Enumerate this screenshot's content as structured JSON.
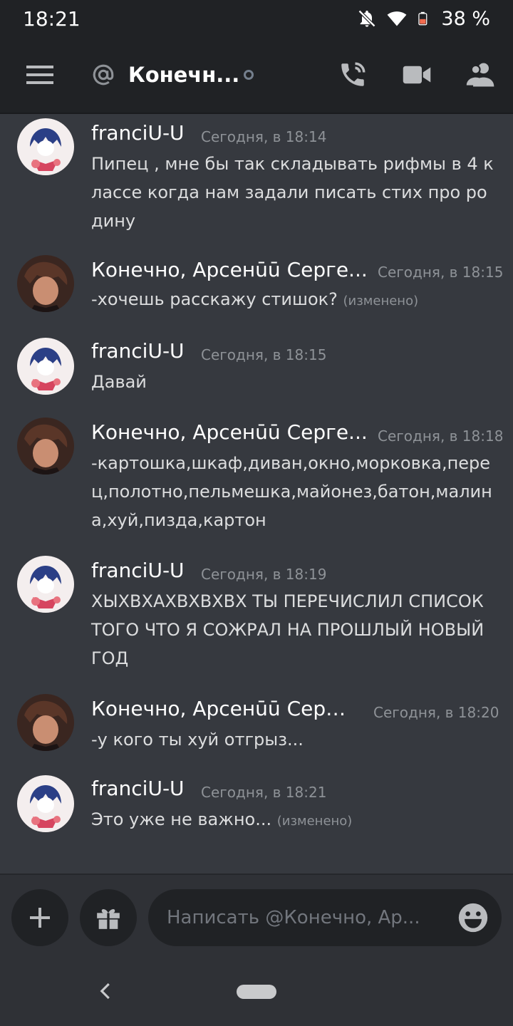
{
  "status_bar": {
    "time": "18:21",
    "battery": "38 %",
    "icons": [
      "bell-off-icon",
      "wifi-icon",
      "battery-icon"
    ]
  },
  "header": {
    "title": "Конечн...",
    "icons": [
      "menu-icon",
      "at-icon",
      "status-dot-icon",
      "call-icon",
      "video-icon",
      "members-icon"
    ]
  },
  "messages": [
    {
      "author": "franciU-U",
      "time": "Сегодня, в 18:14",
      "text": "Пипец , мне бы так складывать рифмы в 4 классе когда нам задали писать стих про родину",
      "edited": ""
    },
    {
      "author": "Конечно, Арсенūū Серге...",
      "time": "Сегодня, в 18:15",
      "text": "-хочешь расскажу стишок?",
      "edited": "(изменено)"
    },
    {
      "author": "franciU-U",
      "time": "Сегодня, в 18:15",
      "text": "Давай",
      "edited": ""
    },
    {
      "author": "Конечно, Арсенūū Серге...",
      "time": "Сегодня, в 18:18",
      "text": "-картошка,шкаф,диван,окно,морковка,перец,полотно,пельмешка,майонез,батон,малина,хуй,пизда,картон",
      "edited": ""
    },
    {
      "author": "franciU-U",
      "time": "Сегодня, в 18:19",
      "text": "ХЫХВХАХВХВХВХ ТЫ ПЕРЕЧИСЛИЛ СПИСОК ТОГО ЧТО Я СОЖРАЛ НА ПРОШЛЫЙ НОВЫЙ ГОД",
      "edited": ""
    },
    {
      "author": "Конечно, Арсенūū Серг...",
      "time": "Сегодня, в 18:20",
      "text": "-у кого ты хуй отгрыз...",
      "edited": ""
    },
    {
      "author": "franciU-U",
      "time": "Сегодня, в 18:21",
      "text": "Это уже не важно...",
      "edited": "(изменено)"
    }
  ],
  "input": {
    "placeholder": "Написать @Конечно, Ар...",
    "icons": [
      "plus-icon",
      "gift-icon",
      "emoji-icon"
    ]
  },
  "nav": {
    "icons": [
      "back-icon",
      "home-pill"
    ]
  },
  "colors": {
    "background": "#36393f",
    "header": "#202225",
    "input_bar": "#2f3136"
  }
}
